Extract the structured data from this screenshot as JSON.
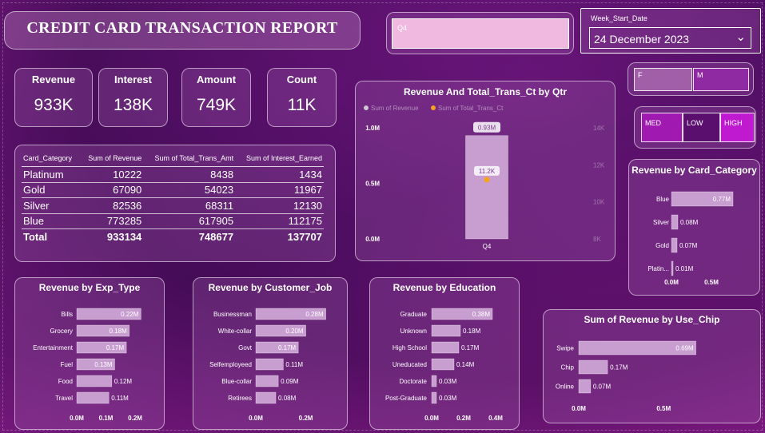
{
  "title": "CREDIT CARD TRANSACTION REPORT",
  "quarter_slicer": {
    "value": "Q4"
  },
  "date_slicer": {
    "label": "Week_Start_Date",
    "value": "24 December 2023"
  },
  "kpis": [
    {
      "label": "Revenue",
      "value": "933K"
    },
    {
      "label": "Interest",
      "value": "138K"
    },
    {
      "label": "Amount",
      "value": "749K"
    },
    {
      "label": "Count",
      "value": "11K"
    }
  ],
  "summary_table": {
    "headers": [
      "Card_Category",
      "Sum of Revenue",
      "Sum of Total_Trans_Amt",
      "Sum of Interest_Earned"
    ],
    "rows": [
      [
        "Platinum",
        "10222",
        "8438",
        "1434"
      ],
      [
        "Gold",
        "67090",
        "54023",
        "11967"
      ],
      [
        "Silver",
        "82536",
        "68311",
        "12130"
      ],
      [
        "Blue",
        "773285",
        "617905",
        "112175"
      ]
    ],
    "total": [
      "Total",
      "933134",
      "748677",
      "137707"
    ]
  },
  "gender_slicer": {
    "options": [
      "F",
      "M"
    ]
  },
  "income_slicer": {
    "options": [
      "MED",
      "LOW",
      "HIGH"
    ]
  },
  "colors": {
    "bar": "#c89ed0",
    "accent_dot": "#f5a31a",
    "highlight": "#c01ad0",
    "selected": "#8f2aa3"
  },
  "chart_data": [
    {
      "type": "bar",
      "title": "Revenue And Total_Trans_Ct by Qtr",
      "legend": [
        "Sum of Revenue",
        "Sum of Total_Trans_Ct"
      ],
      "legend_position": "top-left",
      "categories": [
        "Q4"
      ],
      "series": [
        {
          "name": "Sum of Revenue",
          "values": [
            0.93
          ],
          "labels": [
            "0.93M"
          ],
          "axis": "left"
        },
        {
          "name": "Sum of Total_Trans_Ct",
          "values": [
            11.2
          ],
          "labels": [
            "11.2K"
          ],
          "axis": "right",
          "kind": "point"
        }
      ],
      "y_ticks": [
        "1.0M",
        "0.5M",
        "0.0M"
      ],
      "ylim": [
        0,
        1.0
      ],
      "y2_ticks": [
        "14K",
        "12K",
        "10K",
        "8K"
      ],
      "y2lim": [
        8,
        14
      ]
    },
    {
      "type": "bar",
      "title": "Revenue by Card_Category",
      "orientation": "horizontal",
      "categories": [
        "Blue",
        "Silver",
        "Gold",
        "Platin..."
      ],
      "values": [
        0.77,
        0.08,
        0.07,
        0.01
      ],
      "labels": [
        "0.77M",
        "0.08M",
        "0.07M",
        "0.01M"
      ],
      "x_ticks": [
        "0.0M",
        "0.5M"
      ],
      "xlim": [
        0,
        0.9
      ]
    },
    {
      "type": "bar",
      "title": "Revenue by Exp_Type",
      "orientation": "horizontal",
      "categories": [
        "Bills",
        "Grocery",
        "Entertainment",
        "Fuel",
        "Food",
        "Travel"
      ],
      "values": [
        0.22,
        0.18,
        0.17,
        0.13,
        0.12,
        0.11
      ],
      "labels": [
        "0.22M",
        "0.18M",
        "0.17M",
        "0.13M",
        "0.12M",
        "0.11M"
      ],
      "x_ticks": [
        "0.0M",
        "0.1M",
        "0.2M"
      ],
      "xlim": [
        0,
        0.26
      ]
    },
    {
      "type": "bar",
      "title": "Revenue by Customer_Job",
      "orientation": "horizontal",
      "categories": [
        "Businessman",
        "White-collar",
        "Govt",
        "Selfemployeed",
        "Blue-collar",
        "Retirees"
      ],
      "values": [
        0.28,
        0.2,
        0.17,
        0.11,
        0.09,
        0.08
      ],
      "labels": [
        "0.28M",
        "0.20M",
        "0.17M",
        "0.11M",
        "0.09M",
        "0.08M"
      ],
      "x_ticks": [
        "0.0M",
        "0.2M"
      ],
      "xlim": [
        0,
        0.31
      ]
    },
    {
      "type": "bar",
      "title": "Revenue by Education",
      "orientation": "horizontal",
      "categories": [
        "Graduate",
        "Unknown",
        "High School",
        "Uneducated",
        "Doctorate",
        "Post-Graduate"
      ],
      "values": [
        0.38,
        0.18,
        0.17,
        0.14,
        0.03,
        0.03
      ],
      "labels": [
        "0.38M",
        "0.18M",
        "0.17M",
        "0.14M",
        "0.03M",
        "0.03M"
      ],
      "x_ticks": [
        "0.0M",
        "0.2M",
        "0.4M"
      ],
      "xlim": [
        0,
        0.45
      ]
    },
    {
      "type": "bar",
      "title": "Sum of Revenue by Use_Chip",
      "orientation": "horizontal",
      "categories": [
        "Swipe",
        "Chip",
        "Online"
      ],
      "values": [
        0.69,
        0.17,
        0.07
      ],
      "labels": [
        "0.69M",
        "0.17M",
        "0.07M"
      ],
      "x_ticks": [
        "0.0M",
        "0.5M"
      ],
      "xlim": [
        0,
        0.8
      ]
    }
  ]
}
